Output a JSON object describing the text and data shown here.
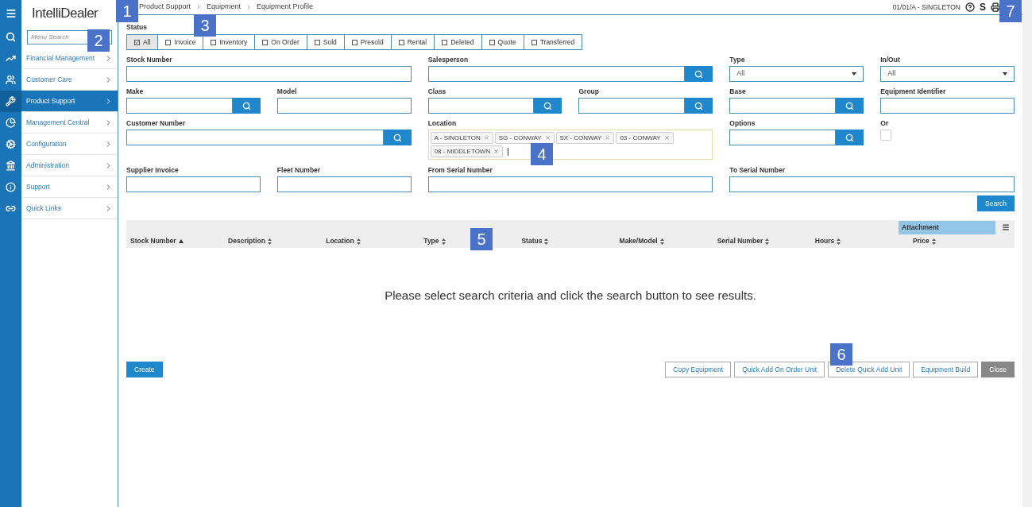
{
  "app": {
    "logo": "IntelliDealer",
    "menu_search": {
      "placeholder": "Menu Search"
    }
  },
  "sidebar": {
    "items": [
      {
        "label": "Financial Management",
        "selected": false
      },
      {
        "label": "Customer Care",
        "selected": false
      },
      {
        "label": "Product Support",
        "selected": true
      },
      {
        "label": "Management Central",
        "selected": false
      },
      {
        "label": "Configuration",
        "selected": false
      },
      {
        "label": "Administration",
        "selected": false
      },
      {
        "label": "Support",
        "selected": false
      },
      {
        "label": "Quick Links",
        "selected": false
      }
    ]
  },
  "breadcrumb": [
    "Product Support",
    "Equipment",
    "Equipment Profile"
  ],
  "header": {
    "location": "01/01/A - SINGLETON",
    "s_icon": "S"
  },
  "status": {
    "label": "Status",
    "options": [
      {
        "label": "All",
        "checked": true
      },
      {
        "label": "Invoice",
        "checked": false
      },
      {
        "label": "Inventory",
        "checked": false
      },
      {
        "label": "On Order",
        "checked": false
      },
      {
        "label": "Sold",
        "checked": false
      },
      {
        "label": "Presold",
        "checked": false
      },
      {
        "label": "Rental",
        "checked": false
      },
      {
        "label": "Deleted",
        "checked": false
      },
      {
        "label": "Quote",
        "checked": false
      },
      {
        "label": "Transferred",
        "checked": false
      }
    ]
  },
  "fields": [
    {
      "kind": "text",
      "label": "Stock Number"
    },
    {
      "kind": "lookup",
      "label": "Salesperson"
    },
    {
      "kind": "select",
      "label": "Type",
      "value": "All"
    },
    {
      "kind": "select",
      "label": "In/Out",
      "value": "All"
    },
    {
      "kind": "lookup",
      "label": "Make"
    },
    {
      "kind": "text",
      "label": "Model"
    },
    {
      "kind": "lookup",
      "label": "Class"
    },
    {
      "kind": "lookup",
      "label": "Group"
    },
    {
      "kind": "lookup",
      "label": "Base"
    },
    {
      "kind": "text",
      "label": "Equipment Identifier"
    },
    {
      "kind": "lookup",
      "label": "Customer Number"
    },
    {
      "kind": "tags",
      "label": "Location",
      "tags": [
        "A - SINGLETON",
        "SG - CONWAY",
        "SX - CONWAY",
        "03 - CONWAY",
        "08 - MIDDLETOWN"
      ]
    },
    {
      "kind": "lookup",
      "label": "Options"
    },
    {
      "kind": "checkbox",
      "label": "Or",
      "checked": false
    },
    {
      "kind": "text",
      "label": "Supplier Invoice"
    },
    {
      "kind": "text",
      "label": "Fleet Number"
    },
    {
      "kind": "text",
      "label": "From Serial Number"
    },
    {
      "kind": "text",
      "label": "To Serial Number"
    }
  ],
  "search_button": "Search",
  "table": {
    "group_header": "Attachment",
    "columns": [
      {
        "label": "Stock Number",
        "sorted": true
      },
      {
        "label": "Description",
        "sorted": false
      },
      {
        "label": "Location",
        "sorted": false
      },
      {
        "label": "Type",
        "sorted": false
      },
      {
        "label": "Status",
        "sorted": false
      },
      {
        "label": "Make/Model",
        "sorted": false
      },
      {
        "label": "Serial Number",
        "sorted": false
      },
      {
        "label": "Hours",
        "sorted": false
      },
      {
        "label": "Price",
        "sorted": false
      }
    ],
    "empty_message": "Please select search criteria and click the search button to see results."
  },
  "create_button": "Create",
  "actions": [
    {
      "label": "Copy Equipment",
      "kind": "outline"
    },
    {
      "label": "Quick Add On Order Unit",
      "kind": "outline"
    },
    {
      "label": "Delete Quick Add Unit",
      "kind": "outline"
    },
    {
      "label": "Equipment Build",
      "kind": "outline"
    },
    {
      "label": "Close",
      "kind": "muted"
    }
  ],
  "callouts": [
    "1",
    "2",
    "3",
    "4",
    "5",
    "6",
    "7"
  ]
}
